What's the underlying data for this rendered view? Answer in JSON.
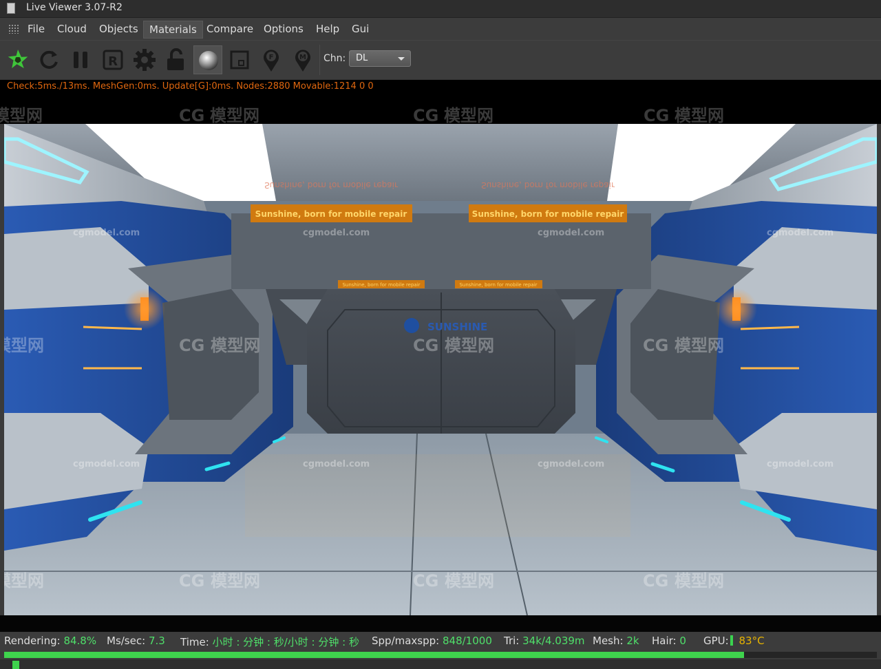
{
  "window": {
    "title": "Live Viewer 3.07-R2"
  },
  "menu": {
    "items": [
      "File",
      "Cloud",
      "Objects",
      "Materials",
      "Compare",
      "Options",
      "Help",
      "Gui"
    ],
    "active": "Materials"
  },
  "toolbar": {
    "buttons": [
      "octane-logo-icon",
      "refresh-icon",
      "pause-icon",
      "r-icon",
      "gear-icon",
      "lock-icon",
      "material-sphere-icon",
      "region-icon",
      "f-pin-icon",
      "m-pin-icon"
    ],
    "channel_label": "Chn:",
    "channel_value": "DL"
  },
  "info": {
    "stats": "Check:5ms./13ms. MeshGen:0ms. Update[G]:0ms. Nodes:2880 Movable:1214  0 0"
  },
  "scene": {
    "sign_text": "Sunshine, born for mobile repair",
    "reflection_text": "Sunshine, born for mobile repair",
    "wall_logo": "SUNSHINE",
    "watermark_site": "cgmodel.com",
    "watermark_cn": "模型网",
    "watermark_badge": "CG"
  },
  "status": {
    "rendering_label": "Rendering:",
    "rendering_value": "84.8%",
    "ms_label": "Ms/sec:",
    "ms_value": "7.3",
    "time_label": "Time:",
    "time_value": "小时 : 分钟 : 秒/小时 : 分钟 : 秒",
    "spp_label": "Spp/maxspp:",
    "spp_value": "848/1000",
    "tri_label": "Tri:",
    "tri_value": "34k/4.039m",
    "mesh_label": "Mesh:",
    "mesh_value": "2k",
    "hair_label": "Hair:",
    "hair_value": "0",
    "gpu_label": "GPU:",
    "gpu_temp": "83°C",
    "progress": 0.848
  },
  "colors": {
    "accent_green": "#3fd34d",
    "stats_orange": "#e0670f",
    "temp_yellow": "#e8b400",
    "corridor_blue": "#1f4a9a",
    "neon_cyan": "#2fe3f0",
    "neon_orange": "#ff8a1a"
  }
}
